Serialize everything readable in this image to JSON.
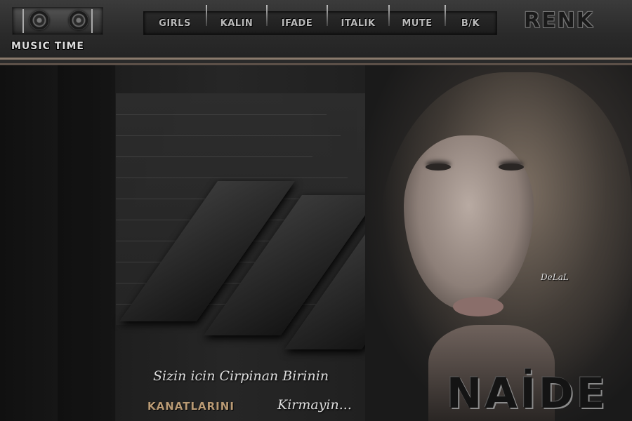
{
  "player": {
    "title": "MUSIC TIME"
  },
  "nav": {
    "items": [
      {
        "label": "GIRLS"
      },
      {
        "label": "KALIN"
      },
      {
        "label": "IFADE"
      },
      {
        "label": "ITALIK"
      },
      {
        "label": "MUTE"
      },
      {
        "label": "B/K"
      }
    ]
  },
  "renk": {
    "label": "RENK"
  },
  "banner": {
    "signature": "DeLaL",
    "tagline_line1": "Sizin icin Cirpinan Birinin",
    "tagline_line2_bold": "KANATLARINI",
    "tagline_line2_script": "Kirmayin...",
    "brand": "NAİDE"
  },
  "colors": {
    "accent_stripe": "#8a7a6c",
    "gold_text": "#b99a74"
  }
}
